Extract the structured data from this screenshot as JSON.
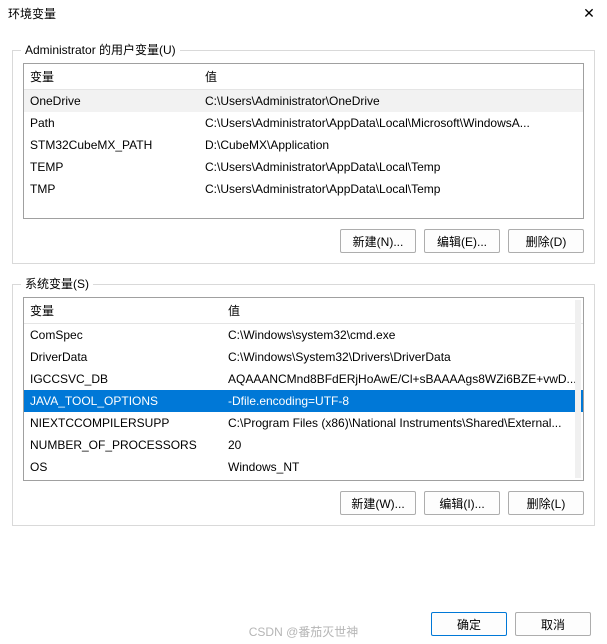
{
  "window": {
    "title": "环境变量",
    "close_glyph": "✕"
  },
  "user_vars": {
    "group_label": "Administrator 的用户变量(U)",
    "headers": {
      "var": "变量",
      "val": "值"
    },
    "rows": [
      {
        "var": "OneDrive",
        "val": "C:\\Users\\Administrator\\OneDrive",
        "selected": false,
        "greyed": true
      },
      {
        "var": "Path",
        "val": "C:\\Users\\Administrator\\AppData\\Local\\Microsoft\\WindowsA...",
        "selected": false,
        "greyed": false
      },
      {
        "var": "STM32CubeMX_PATH",
        "val": "D:\\CubeMX\\Application",
        "selected": false,
        "greyed": false
      },
      {
        "var": "TEMP",
        "val": "C:\\Users\\Administrator\\AppData\\Local\\Temp",
        "selected": false,
        "greyed": false
      },
      {
        "var": "TMP",
        "val": "C:\\Users\\Administrator\\AppData\\Local\\Temp",
        "selected": false,
        "greyed": false
      }
    ],
    "buttons": {
      "new": "新建(N)...",
      "edit": "编辑(E)...",
      "delete": "删除(D)"
    }
  },
  "system_vars": {
    "group_label": "系统变量(S)",
    "headers": {
      "var": "变量",
      "val": "值"
    },
    "rows": [
      {
        "var": "ComSpec",
        "val": "C:\\Windows\\system32\\cmd.exe",
        "selected": false,
        "greyed": false
      },
      {
        "var": "DriverData",
        "val": "C:\\Windows\\System32\\Drivers\\DriverData",
        "selected": false,
        "greyed": false
      },
      {
        "var": "IGCCSVC_DB",
        "val": "AQAAANCMnd8BFdERjHoAwE/Cl+sBAAAAgs8WZi6BZE+vwD...",
        "selected": false,
        "greyed": false
      },
      {
        "var": "JAVA_TOOL_OPTIONS",
        "val": "-Dfile.encoding=UTF-8",
        "selected": true,
        "greyed": false
      },
      {
        "var": "NIEXTCCOMPILERSUPP",
        "val": "C:\\Program Files (x86)\\National Instruments\\Shared\\External...",
        "selected": false,
        "greyed": false
      },
      {
        "var": "NUMBER_OF_PROCESSORS",
        "val": "20",
        "selected": false,
        "greyed": false
      },
      {
        "var": "OS",
        "val": "Windows_NT",
        "selected": false,
        "greyed": false
      }
    ],
    "buttons": {
      "new": "新建(W)...",
      "edit": "编辑(I)...",
      "delete": "删除(L)"
    }
  },
  "footer": {
    "ok": "确定",
    "cancel": "取消"
  },
  "watermark": "CSDN @番茄灭世神"
}
